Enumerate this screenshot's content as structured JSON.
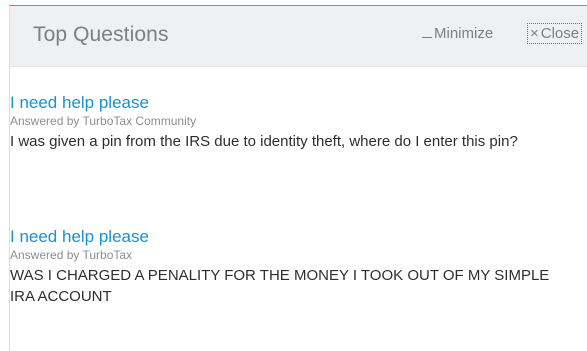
{
  "header": {
    "title": "Top Questions",
    "minimize_label": "Minimize",
    "close_label": "Close",
    "minimize_icon": "minus-icon",
    "close_icon": "x-icon",
    "close_glyph": "×"
  },
  "questions": [
    {
      "title": "I need help please",
      "answered_by": "Answered by TurboTax Community",
      "body": "I was given a pin from the IRS due to identity theft, where do I enter this pin?"
    },
    {
      "title": "I need help please",
      "answered_by": "Answered by TurboTax",
      "body": "WAS I CHARGED A PENALITY FOR THE MONEY I TOOK OUT OF MY SIMPLE IRA ACCOUNT"
    }
  ],
  "colors": {
    "accent": "#1e8fcf",
    "header_bg": "#eef0f2",
    "muted_text": "#7b8085"
  }
}
